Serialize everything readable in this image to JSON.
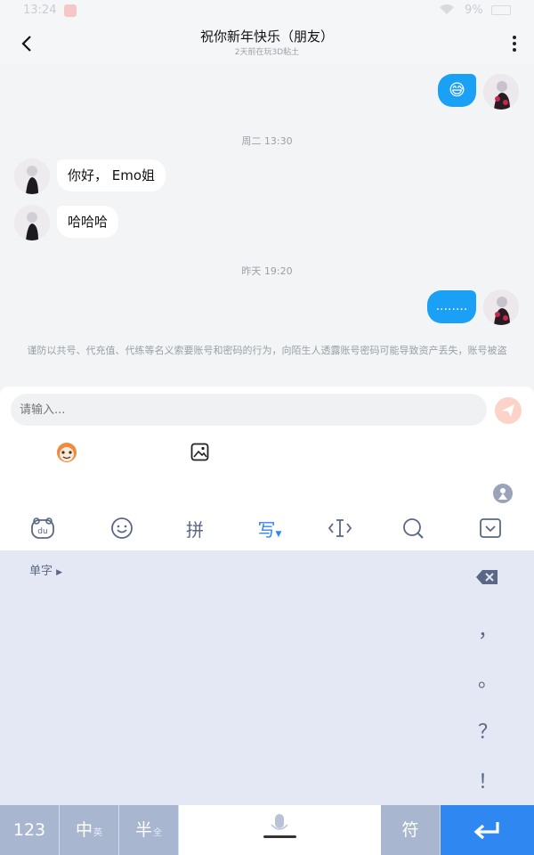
{
  "status_bar": {
    "time": "13:24",
    "battery": "9%"
  },
  "header": {
    "title": "祝你新年快乐（朋友）",
    "subtitle": "2天前在玩3D粘土"
  },
  "messages": {
    "out1_text": "😅",
    "sep1": "周二 13:30",
    "in1_text": "你好， Emo姐",
    "in2_text": "哈哈哈",
    "sep2": "昨天 19:20",
    "out2_text": "........",
    "warning": "谨防以共号、代充值、代练等名义索要账号和密码的行为，向陌生人透露账号密码可能导致资产丢失，账号被盗"
  },
  "input": {
    "placeholder": "请输入..."
  },
  "keyboard": {
    "tools": [
      "du",
      "☺",
      "拼",
      "写",
      "⟨I⟩",
      "Q",
      "∨"
    ],
    "single_char": "单字",
    "punctuation": [
      "，",
      "。",
      "？",
      "！"
    ],
    "keys": {
      "num": "123",
      "zh": "中",
      "zh_sub": "英",
      "half": "半",
      "half_sub": "全",
      "symbol": "符"
    }
  },
  "colors": {
    "accent": "#1aa1f6",
    "keyboard_bg": "#e4e8f4",
    "enter": "#2f87f2"
  }
}
